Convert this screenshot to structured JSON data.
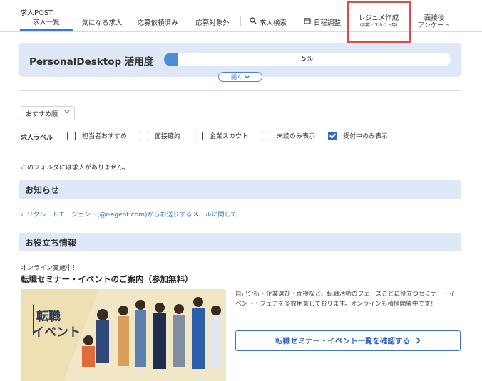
{
  "app": {
    "title": "求人POST"
  },
  "nav": {
    "tabs": [
      {
        "label": "求人一覧"
      },
      {
        "label": "気になる求人"
      },
      {
        "label": "応募依頼済み"
      },
      {
        "label": "応募対象外"
      },
      {
        "label": "求人検索",
        "icon": "search-icon"
      },
      {
        "label": "日程調整",
        "icon": "calendar-icon"
      },
      {
        "label": "レジュメ作成",
        "sub": "(応募／スカウト用)"
      },
      {
        "label": "面接後",
        "sub": "アンケート"
      }
    ],
    "active_index": 0,
    "highlight_color": "#e04a4a"
  },
  "usage": {
    "title": "PersonalDesktop 活用度",
    "percent_label": "5%",
    "percent": 5,
    "expand_label": "開く"
  },
  "sort": {
    "selected": "おすすめ順"
  },
  "filters": {
    "label": "求人ラベル",
    "options": [
      {
        "label": "担当者おすすめ",
        "checked": false
      },
      {
        "label": "面接確約",
        "checked": false
      },
      {
        "label": "企業スカウト",
        "checked": false
      },
      {
        "label": "未読のみ表示",
        "checked": false
      },
      {
        "label": "受付中のみ表示",
        "checked": true
      }
    ]
  },
  "empty_message": "このフォルダには求人がありません。",
  "news": {
    "heading": "お知らせ",
    "link": "リクルートエージェント(@r-agent.com)からお送りするメールに関して"
  },
  "info": {
    "heading": "お役立ち情報",
    "online_note": "オンライン実施中！",
    "event_title": "転職セミナー・イベントのご案内（参加無料）",
    "banner_line1": "転職",
    "banner_line2": "イベント",
    "description": "自己分析・企業選び・面接など、転職活動のフェーズごとに役立つセミナー・イベント・フェアを多数用意しております。オンラインも積極開催中です！",
    "button": "転職セミナー・イベント一覧を確認する"
  },
  "colors": {
    "accent": "#2f6cc5",
    "panel": "#dfe8f7"
  }
}
